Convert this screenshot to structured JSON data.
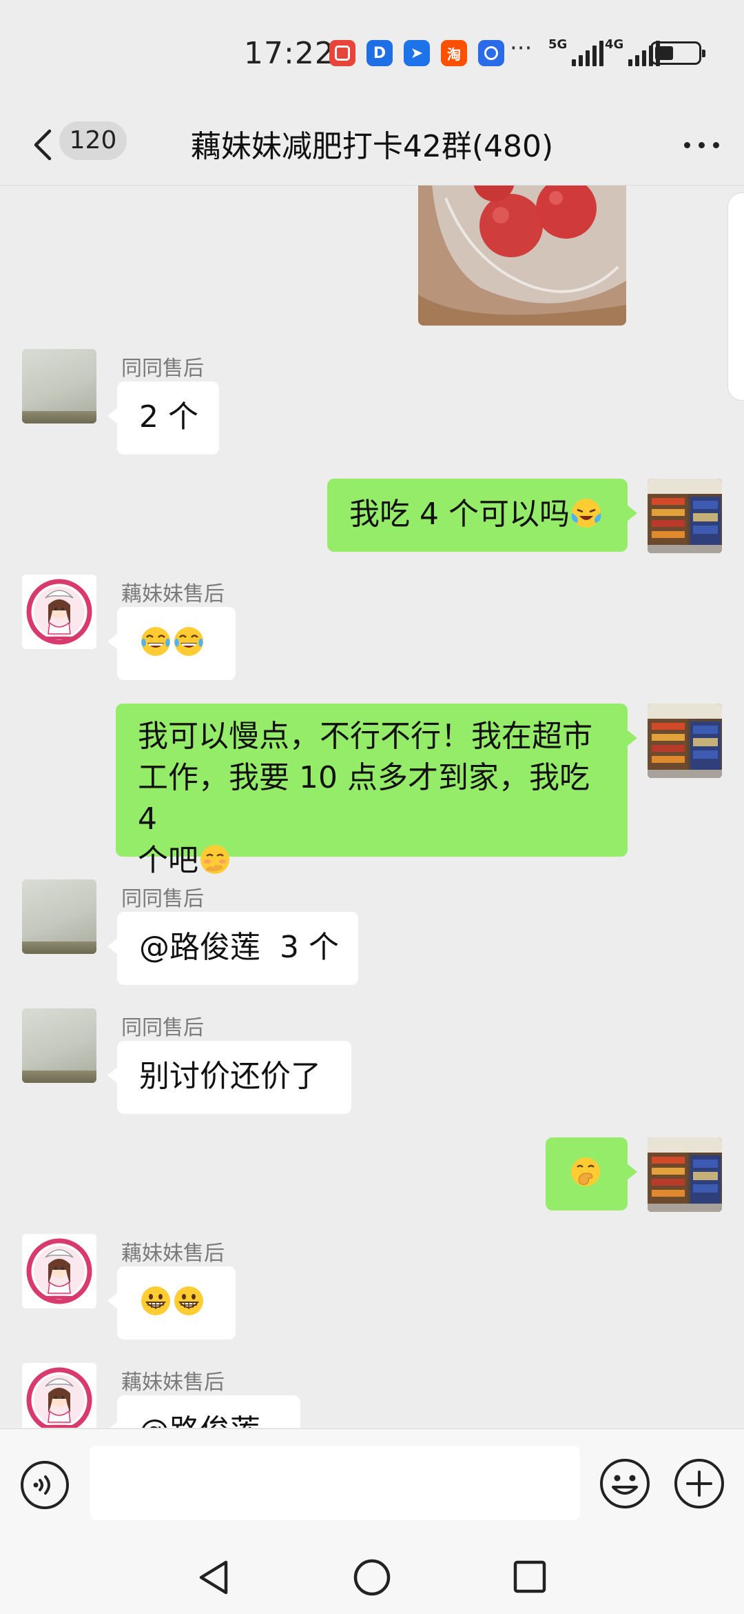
{
  "status_bar": {
    "time": "17:22",
    "notification_icons": [
      "red-app-icon",
      "dingtalk-icon",
      "feishu-icon",
      "taobao-icon",
      "blue-app-icon"
    ],
    "overflow": "···",
    "signal_1": "5G",
    "signal_2": "4G"
  },
  "header": {
    "back_icon": "chevron-left-icon",
    "unread_count": "120",
    "title": "藕妹妹减肥打卡42群(480)",
    "more_icon": "more-dots-icon"
  },
  "messages": [
    {
      "side": "left",
      "sender": "同同售后",
      "text": "2 个"
    },
    {
      "side": "right",
      "text": "我吃 4 个可以吗",
      "emoji": "crying-laughing-emoji"
    },
    {
      "side": "left",
      "sender": "藕妹妹售后",
      "emojis": [
        "tears-of-joy-emoji",
        "tears-of-joy-emoji"
      ]
    },
    {
      "side": "right",
      "lines": [
        "我可以慢点，不行不行！我在超市",
        "工作，我要 10 点多才到家，我吃 4",
        "个吧"
      ],
      "emoji": "shy-face-emoji"
    },
    {
      "side": "left",
      "sender": "同同售后",
      "text": "@路俊莲  3 个"
    },
    {
      "side": "left",
      "sender": "同同售后",
      "text": "别讨价还价了"
    },
    {
      "side": "right",
      "emoji": "hand-over-mouth-emoji"
    },
    {
      "side": "left",
      "sender": "藕妹妹售后",
      "emojis": [
        "grinning-face-emoji",
        "grinning-face-emoji"
      ]
    },
    {
      "side": "left",
      "sender": "藕妹妹售后",
      "text": "@路俊莲"
    }
  ],
  "input_bar": {
    "voice_icon": "voice-icon",
    "emoji_icon": "emoji-icon",
    "plus_icon": "plus-icon"
  },
  "nav_bar": {
    "icons": [
      "back-triangle-icon",
      "home-circle-icon",
      "recents-square-icon"
    ]
  },
  "colors": {
    "background": "#EDEDED",
    "bubble_self": "#95EC69",
    "bubble_other": "#FFFFFF",
    "sender_name": "#7A7A7A"
  }
}
